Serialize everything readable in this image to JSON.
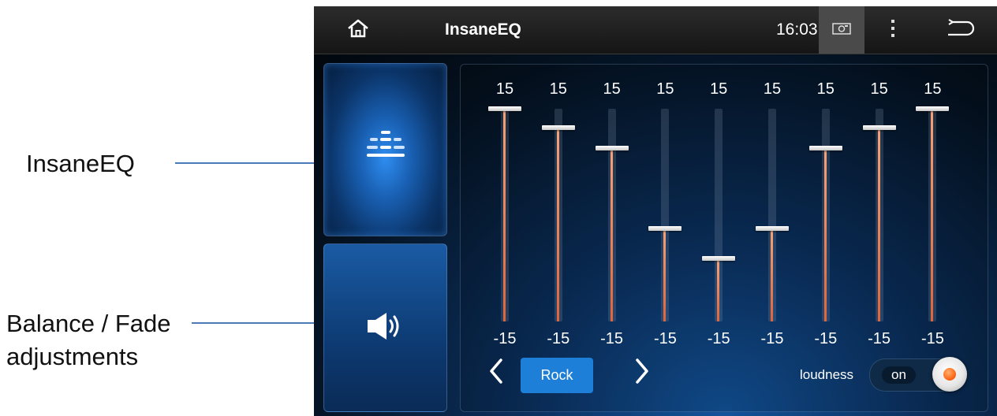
{
  "annotations": {
    "eq_label": "InsaneEQ",
    "balance_line1": "Balance / Fade",
    "balance_line2": "adjustments"
  },
  "statusbar": {
    "home_icon": "home-icon",
    "title": "InsaneEQ",
    "time": "16:03",
    "screenshot_icon": "screenshot-icon",
    "menu_icon": "more-vert-icon",
    "back_icon": "back-icon"
  },
  "sidebar": {
    "eq_tab_icon": "equalizer-icon",
    "balance_tab_icon": "speaker-icon"
  },
  "equalizer": {
    "range_max": 15,
    "range_min": -15,
    "bands": [
      {
        "max_label": "15",
        "min_label": "-15",
        "level": 15
      },
      {
        "max_label": "15",
        "min_label": "-15",
        "level": 12.3
      },
      {
        "max_label": "15",
        "min_label": "-15",
        "level": 9.5
      },
      {
        "max_label": "15",
        "min_label": "-15",
        "level": -1.9
      },
      {
        "max_label": "15",
        "min_label": "-15",
        "level": -6.1
      },
      {
        "max_label": "15",
        "min_label": "-15",
        "level": -1.9
      },
      {
        "max_label": "15",
        "min_label": "-15",
        "level": 9.5
      },
      {
        "max_label": "15",
        "min_label": "-15",
        "level": 12.3
      },
      {
        "max_label": "15",
        "min_label": "-15",
        "level": 15
      }
    ],
    "preset": "Rock",
    "prev_icon": "chevron-left-icon",
    "next_icon": "chevron-right-icon"
  },
  "loudness": {
    "label": "loudness",
    "state": "on"
  },
  "colors": {
    "accent": "#1e7fd8",
    "slider_fill": "#e0643a",
    "toggle_dot": "#ff6a1a"
  }
}
